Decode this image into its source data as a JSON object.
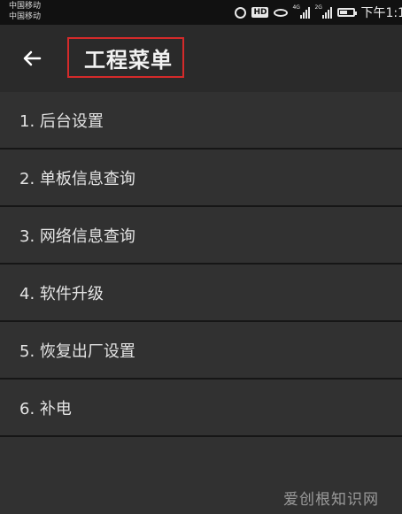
{
  "status_bar": {
    "carrier_1": "中国移动",
    "carrier_2": "中国移动",
    "net_1": "4G",
    "net_2": "2G",
    "battery_level": 0.55,
    "time": "下午1:1"
  },
  "app_bar": {
    "title": "工程菜单"
  },
  "menu": {
    "items": [
      {
        "label": "1. 后台设置"
      },
      {
        "label": "2. 单板信息查询"
      },
      {
        "label": "3. 网络信息查询"
      },
      {
        "label": "4. 软件升级"
      },
      {
        "label": "5. 恢复出厂设置"
      },
      {
        "label": "6. 补电"
      }
    ]
  },
  "watermark": "爱创根知识网",
  "colors": {
    "background": "#313131",
    "app_bar": "#2a2a2a",
    "highlight_box": "#d42a2a"
  }
}
